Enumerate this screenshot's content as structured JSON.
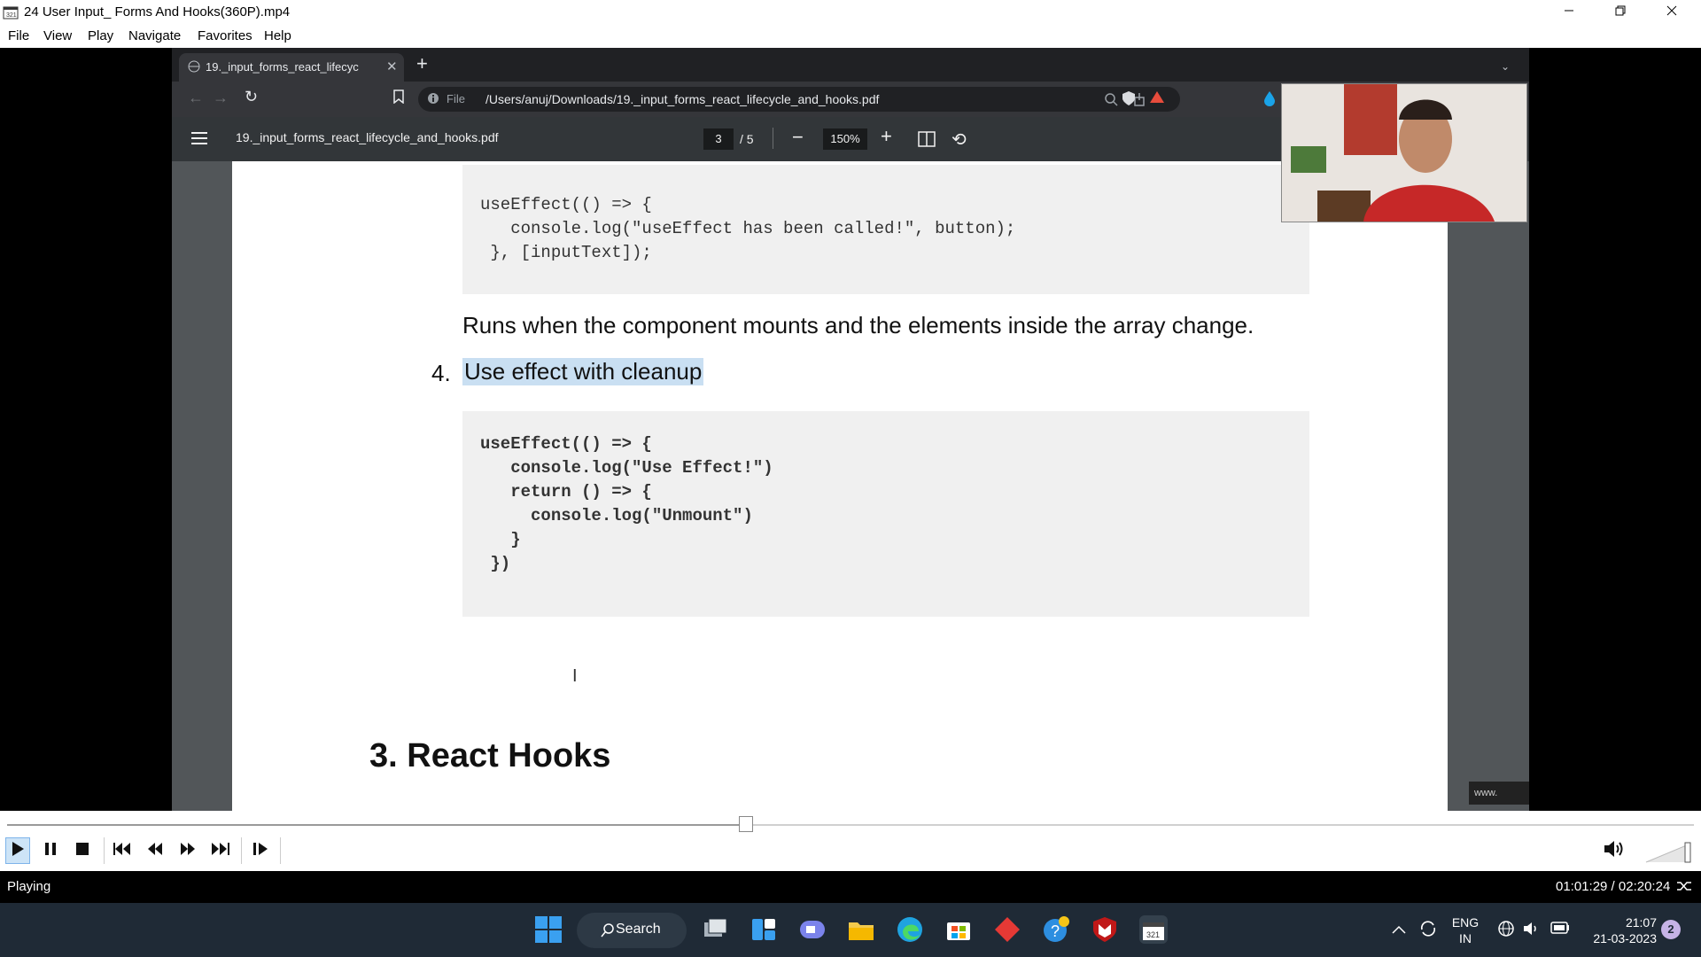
{
  "window": {
    "title": "24 User Input_ Forms And Hooks(360P).mp4",
    "minimize_icon": "minimize-icon",
    "restore_icon": "restore-icon",
    "close_icon": "close-icon"
  },
  "menu": {
    "items": [
      "File",
      "View",
      "Play",
      "Navigate",
      "Favorites",
      "Help"
    ]
  },
  "browser": {
    "tab_title": "19._input_forms_react_lifecyc",
    "url_prefix": "File",
    "url": "/Users/anuj/Downloads/19._input_forms_react_lifecycle_and_hooks.pdf"
  },
  "pdf_viewer": {
    "file_name": "19._input_forms_react_lifecycle_and_hooks.pdf",
    "current_page": "3",
    "total_pages": "/ 5",
    "zoom": "150%"
  },
  "document": {
    "code_block_1": "useEffect(() => {\n   console.log(\"useEffect has been called!\", button);\n }, [inputText]);",
    "paragraph": "Runs when the component mounts and the elements inside the array change.",
    "list_number": "4.",
    "list_heading": "Use effect with cleanup",
    "code_block_2": "useEffect(() => {\n   console.log(\"Use Effect!\")\n   return () => {\n     console.log(\"Unmount\")\n   }\n })",
    "section_heading": "3. React Hooks",
    "watermark": "www."
  },
  "player": {
    "progress": 0.438,
    "status": "Playing",
    "time": "01:01:29 / 02:20:24"
  },
  "taskbar": {
    "search_label": "Search",
    "lang_top": "ENG",
    "lang_bottom": "IN",
    "clock_time": "21:07",
    "clock_date": "21-03-2023",
    "notification_count": "2"
  },
  "colors": {
    "taskbar_bg": "#1f2a36",
    "status_bg": "#000000",
    "accent": "#0078d4"
  }
}
